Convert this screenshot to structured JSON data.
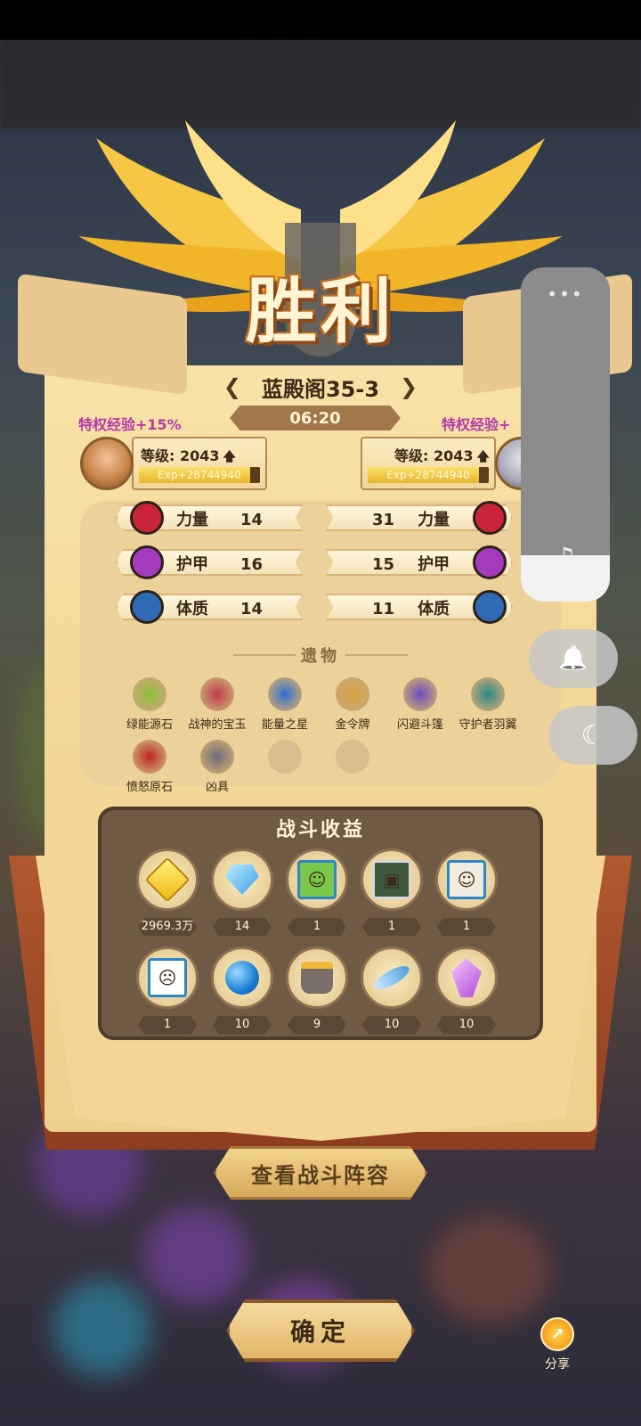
{
  "stage": {
    "name": "蓝殿阁35-3",
    "prev": "❮",
    "next": "❯"
  },
  "title": "胜利",
  "timer": "06:20",
  "left_player": {
    "privilege": "特权经验+15%",
    "level": "等级: 2043",
    "exp": "Exp+28744940",
    "exp_fill": 0.92
  },
  "right_player": {
    "privilege": "特权经验+",
    "level": "等级: 2043",
    "exp": "Exp+28744940",
    "exp_fill": 0.92
  },
  "up_arrow": "🡅",
  "stats_left": [
    {
      "label": "力量",
      "value": "14",
      "icon": "fist-icon",
      "color": "#c9243a"
    },
    {
      "label": "护甲",
      "value": "16",
      "icon": "armor-icon",
      "color": "#a43bbd"
    },
    {
      "label": "体质",
      "value": "14",
      "icon": "heart-icon",
      "color": "#2f6bb5"
    }
  ],
  "stats_right": [
    {
      "label": "力量",
      "value": "31",
      "icon": "fist-icon",
      "color": "#c9243a"
    },
    {
      "label": "护甲",
      "value": "15",
      "icon": "armor-icon",
      "color": "#a43bbd"
    },
    {
      "label": "体质",
      "value": "11",
      "icon": "heart-icon",
      "color": "#2f6bb5"
    }
  ],
  "relics_title": "遗物",
  "relics": [
    {
      "label": "绿能源石",
      "icon": "green-stone-icon"
    },
    {
      "label": "战神的宝玉",
      "icon": "war-jade-icon"
    },
    {
      "label": "能量之星",
      "icon": "energy-star-icon"
    },
    {
      "label": "金令牌",
      "icon": "gold-token-icon"
    },
    {
      "label": "闪避斗篷",
      "icon": "dodge-cloak-icon"
    },
    {
      "label": "守护者羽翼",
      "icon": "guardian-wing-icon"
    },
    {
      "label": "愤怒原石",
      "icon": "rage-stone-icon"
    },
    {
      "label": "凶具",
      "icon": "fierce-mask-icon"
    }
  ],
  "gains_title": "战斗收益",
  "gains": [
    {
      "count": "2969.3万",
      "icon": "gold-gem-icon"
    },
    {
      "count": "14",
      "icon": "blue-diamond-icon"
    },
    {
      "count": "1",
      "icon": "green-hero-card-icon"
    },
    {
      "count": "1",
      "icon": "tank-hero-card-icon"
    },
    {
      "count": "1",
      "icon": "white-hero-card-icon"
    },
    {
      "count": "1",
      "icon": "box-hero-card-icon"
    },
    {
      "count": "10",
      "icon": "blue-orb-icon"
    },
    {
      "count": "9",
      "icon": "gold-bucket-icon"
    },
    {
      "count": "10",
      "icon": "feather-icon"
    },
    {
      "count": "10",
      "icon": "purple-crystal-icon"
    }
  ],
  "buttons": {
    "lineup": "查看战斗阵容",
    "confirm": "确定",
    "share": "分享"
  },
  "system": {
    "dots": "•••",
    "note": "♫",
    "bell": "🔔",
    "moon": "☾"
  }
}
